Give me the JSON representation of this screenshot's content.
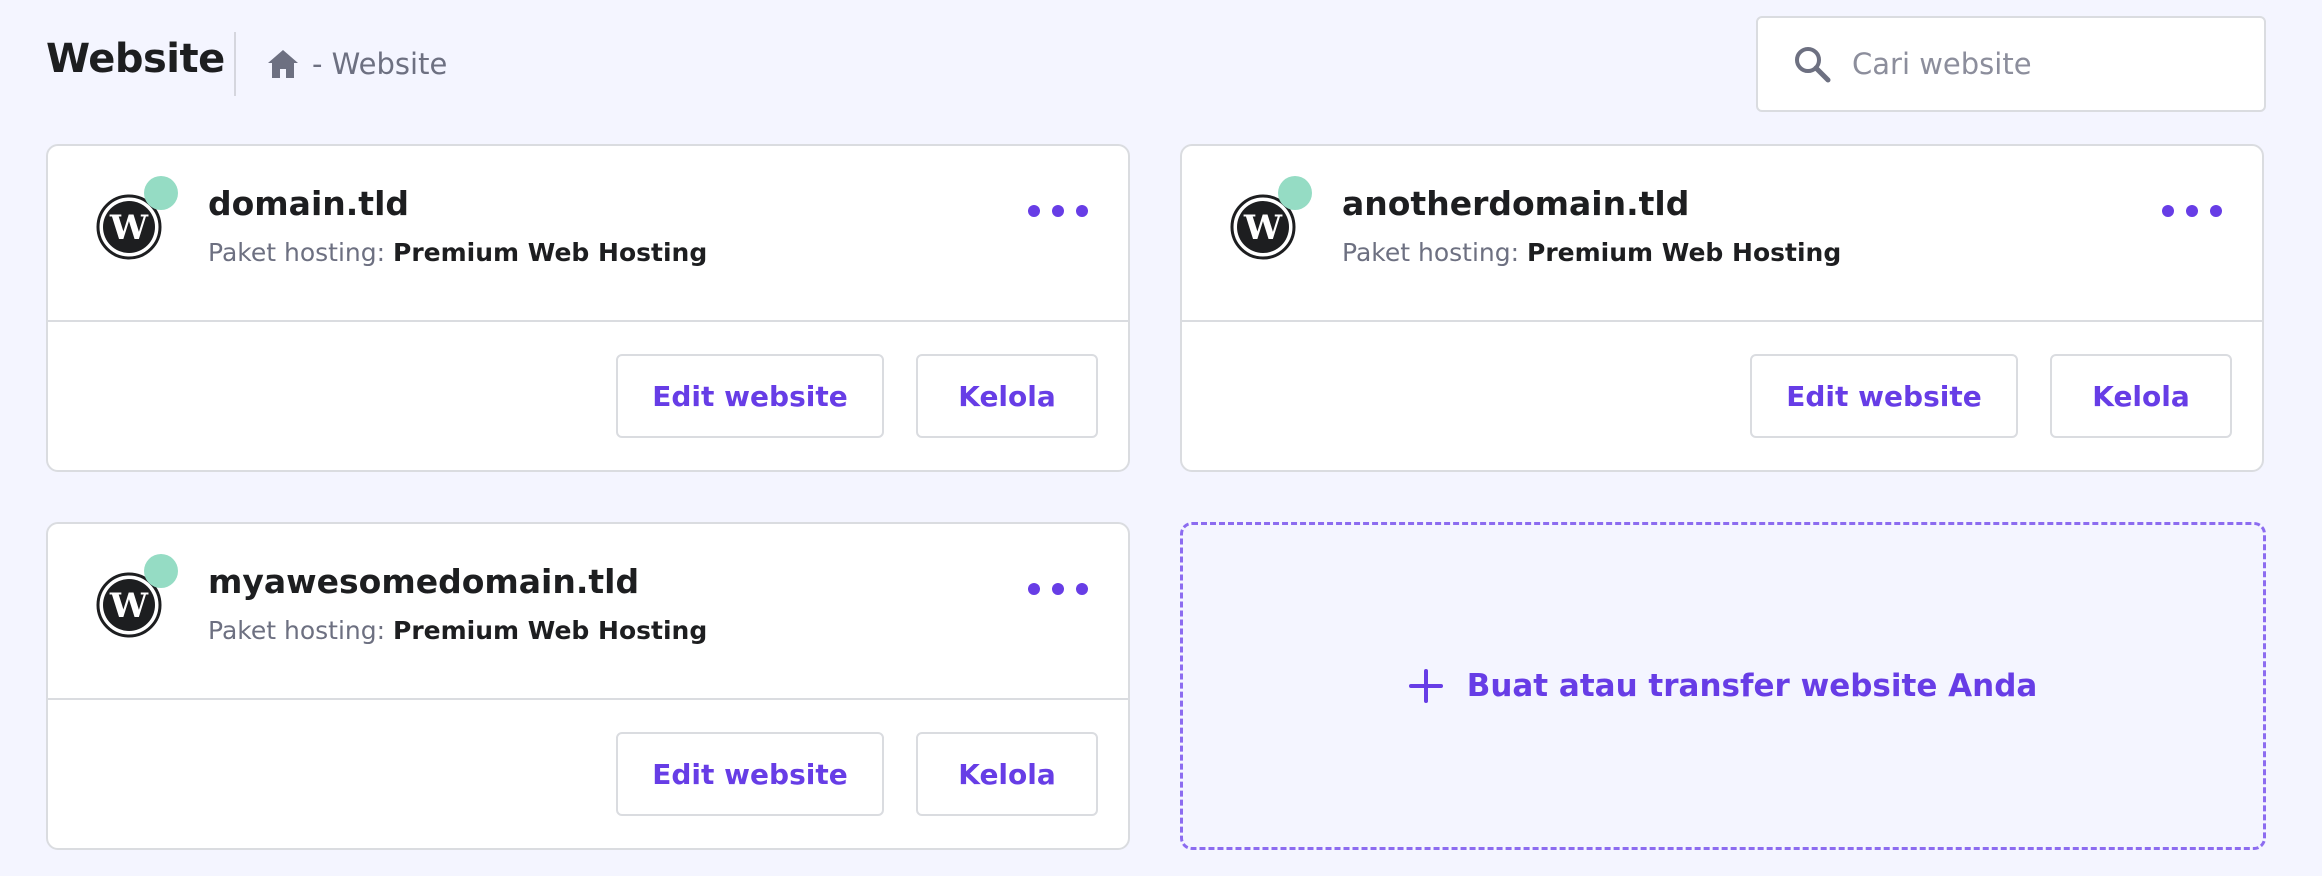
{
  "header": {
    "title": "Website",
    "breadcrumb": {
      "home_icon": "home-icon",
      "separator_text": "- Website"
    },
    "search": {
      "placeholder": "Cari website",
      "value": "",
      "icon": "search-icon"
    }
  },
  "websites": [
    {
      "domain": "domain.tld",
      "plan_label": "Paket hosting:",
      "plan_value": "Premium Web Hosting",
      "logo": "wordpress-icon",
      "status_color": "#95dcc4",
      "edit_label": "Edit website",
      "manage_label": "Kelola"
    },
    {
      "domain": "anotherdomain.tld",
      "plan_label": "Paket hosting:",
      "plan_value": "Premium Web Hosting",
      "logo": "wordpress-icon",
      "status_color": "#95dcc4",
      "edit_label": "Edit website",
      "manage_label": "Kelola"
    },
    {
      "domain": "myawesomedomain.tld",
      "plan_label": "Paket hosting:",
      "plan_value": "Premium Web Hosting",
      "logo": "wordpress-icon",
      "status_color": "#95dcc4",
      "edit_label": "Edit website",
      "manage_label": "Kelola"
    }
  ],
  "add_website": {
    "label": "Buat atau transfer website Anda",
    "icon": "plus-icon"
  },
  "colors": {
    "accent": "#673de6",
    "background": "#f4f5ff",
    "status_active": "#95dcc4"
  }
}
